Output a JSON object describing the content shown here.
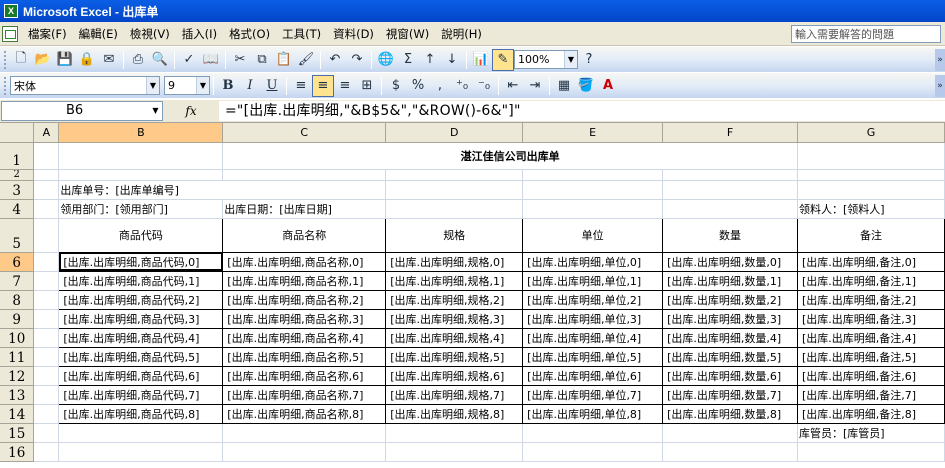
{
  "window": {
    "title": "Microsoft Excel - 出库单",
    "app_icon": "excel-icon"
  },
  "menu": {
    "items": [
      "檔案(F)",
      "編輯(E)",
      "檢視(V)",
      "插入(I)",
      "格式(O)",
      "工具(T)",
      "資料(D)",
      "視窗(W)",
      "說明(H)"
    ],
    "help_placeholder": "輸入需要解答的問題"
  },
  "toolbar1": {
    "zoom": "100%"
  },
  "toolbar2": {
    "font_name": "宋体",
    "font_size": "9"
  },
  "formula_bar": {
    "name_box": "B6",
    "fx_label": "fx",
    "formula": "=\"[出库.出库明细,\"&B$5&\",\"&ROW()-6&\"]\""
  },
  "sheet": {
    "columns": [
      "A",
      "B",
      "C",
      "D",
      "E",
      "F",
      "G"
    ],
    "selected_column": "B",
    "selected_row": "6",
    "active_cell": "B6",
    "title": "湛江佳信公司出库单",
    "order_no": "出库单号：[出库单编号]",
    "dept": "领用部门：[领用部门]",
    "date": "出库日期：[出库日期]",
    "receiver": "领料人：[领料人]",
    "keeper": "库管员：[库管员]",
    "headers": [
      "商品代码",
      "商品名称",
      "规格",
      "单位",
      "数量",
      "备注"
    ],
    "rows": [
      [
        "[出库.出库明细,商品代码,0]",
        "[出库.出库明细,商品名称,0]",
        "[出库.出库明细,规格,0]",
        "[出库.出库明细,单位,0]",
        "[出库.出库明细,数量,0]",
        "[出库.出库明细,备注,0]"
      ],
      [
        "[出库.出库明细,商品代码,1]",
        "[出库.出库明细,商品名称,1]",
        "[出库.出库明细,规格,1]",
        "[出库.出库明细,单位,1]",
        "[出库.出库明细,数量,1]",
        "[出库.出库明细,备注,1]"
      ],
      [
        "[出库.出库明细,商品代码,2]",
        "[出库.出库明细,商品名称,2]",
        "[出库.出库明细,规格,2]",
        "[出库.出库明细,单位,2]",
        "[出库.出库明细,数量,2]",
        "[出库.出库明细,备注,2]"
      ],
      [
        "[出库.出库明细,商品代码,3]",
        "[出库.出库明细,商品名称,3]",
        "[出库.出库明细,规格,3]",
        "[出库.出库明细,单位,3]",
        "[出库.出库明细,数量,3]",
        "[出库.出库明细,备注,3]"
      ],
      [
        "[出库.出库明细,商品代码,4]",
        "[出库.出库明细,商品名称,4]",
        "[出库.出库明细,规格,4]",
        "[出库.出库明细,单位,4]",
        "[出库.出库明细,数量,4]",
        "[出库.出库明细,备注,4]"
      ],
      [
        "[出库.出库明细,商品代码,5]",
        "[出库.出库明细,商品名称,5]",
        "[出库.出库明细,规格,5]",
        "[出库.出库明细,单位,5]",
        "[出库.出库明细,数量,5]",
        "[出库.出库明细,备注,5]"
      ],
      [
        "[出库.出库明细,商品代码,6]",
        "[出库.出库明细,商品名称,6]",
        "[出库.出库明细,规格,6]",
        "[出库.出库明细,单位,6]",
        "[出库.出库明细,数量,6]",
        "[出库.出库明细,备注,6]"
      ],
      [
        "[出库.出库明细,商品代码,7]",
        "[出库.出库明细,商品名称,7]",
        "[出库.出库明细,规格,7]",
        "[出库.出库明细,单位,7]",
        "[出库.出库明细,数量,7]",
        "[出库.出库明细,备注,7]"
      ],
      [
        "[出库.出库明细,商品代码,8]",
        "[出库.出库明细,商品名称,8]",
        "[出库.出库明细,规格,8]",
        "[出库.出库明细,单位,8]",
        "[出库.出库明细,数量,8]",
        "[出库.出库明细,备注,8]"
      ]
    ],
    "row_numbers": [
      "1",
      "2",
      "3",
      "4",
      "5",
      "6",
      "7",
      "8",
      "9",
      "10",
      "11",
      "12",
      "13",
      "14",
      "15",
      "16"
    ]
  },
  "colors": {
    "title_bar": "#0a5fe6",
    "selection": "#ffc98a",
    "chrome": "#ece9d8"
  }
}
